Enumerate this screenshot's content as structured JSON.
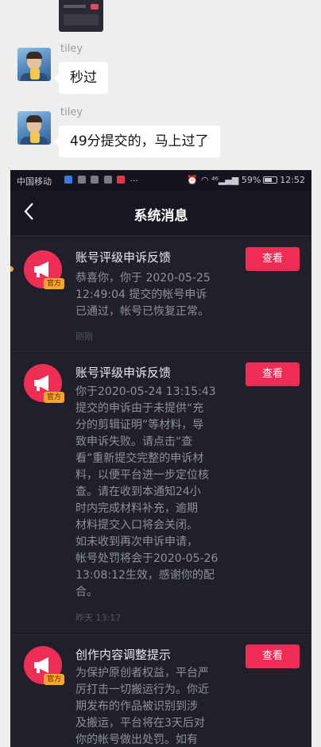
{
  "chat": {
    "messages": [
      {
        "sender": "tiley",
        "text": "秒过"
      },
      {
        "sender": "tiley",
        "text": "49分提交的，马上过了"
      }
    ]
  },
  "status_bar": {
    "carrier": "中国移动",
    "more": "···",
    "signal": "⁴⁶",
    "battery": "59%",
    "time": "12:52"
  },
  "nav": {
    "back_icon": "chevron-left-icon",
    "title": "系统消息"
  },
  "notifications": [
    {
      "title": "账号评级申诉反馈",
      "badge": "官方",
      "body": "恭喜你，你于 2020-05-25\n12:49:04 提交的帐号申诉\n已通过，帐号已恢复正常。",
      "time": "刚刚",
      "button": "查看"
    },
    {
      "title": "账号评级申诉反馈",
      "badge": "官方",
      "body": "你于2020-05-24 13:15:43\n提交的申诉由于未提供“充\n分的剪辑证明”等材料，导\n致申诉失败。请点击“查\n看”重新提交完整的申诉材\n料，以便平台进一步定位核\n查。请在收到本通知24小\n时内完成材料补充，逾期\n材料提交入口将会关闭。\n如未收到再次申诉申请，\n帐号处罚将会于2020-05-26\n13:08:12生效，感谢你的配\n合。",
      "time": "昨天 13:17",
      "button": "查看"
    },
    {
      "title": "创作内容调整提示",
      "badge": "官方",
      "body": "为保护原创者权益，平台严\n厉打击一切搬运行为。你近\n期发布的作品被识别到涉\n及搬运，平台将在3天后对\n你的帐号做出处罚。如有",
      "time": "",
      "button": "查看"
    }
  ],
  "colors": {
    "accent": "#ee2c55",
    "badge": "#f3a52e",
    "background": "#161720",
    "card": "#1f2029"
  }
}
